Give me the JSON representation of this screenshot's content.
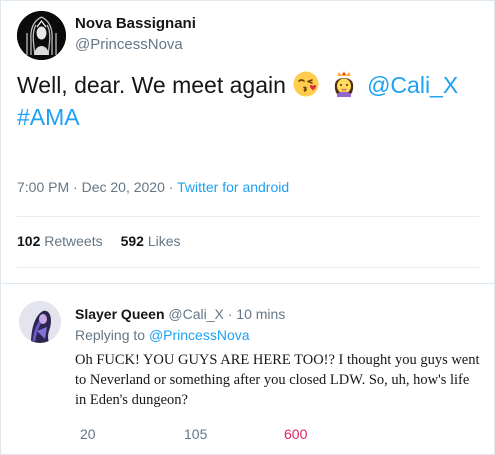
{
  "tweet": {
    "author_name": "Nova Bassignani",
    "author_handle": "@PrincessNova",
    "text_main": "Well, dear. We meet again",
    "emojis": [
      "kissing-face-icon",
      "princess-icon"
    ],
    "mention": "@Cali_X",
    "hashtag": "#AMA",
    "time": "7:00 PM",
    "date_sep": " · ",
    "date": "Dec 20, 2020",
    "source_sep": " · ",
    "source": "Twitter for android",
    "retweets_count": "102",
    "retweets_label": "Retweets",
    "likes_count": "592",
    "likes_label": "Likes"
  },
  "reply": {
    "name": "Slayer Queen",
    "handle": "@Cali_X",
    "time_sep": " · ",
    "time": "10 mins",
    "replying_prefix": "Replying to",
    "replying_to": "@PrincessNova",
    "text": "Oh FUCK! YOU GUYS ARE HERE TOO!? I thought you guys went to Neverland or something after you closed LDW. So, uh, how's life in Eden's dungeon?",
    "reply_count": "20",
    "retweet_count": "105",
    "like_count": "600"
  },
  "colors": {
    "link": "#1da1f2",
    "muted": "#657786",
    "like": "#e0245e",
    "text": "#14171a"
  }
}
